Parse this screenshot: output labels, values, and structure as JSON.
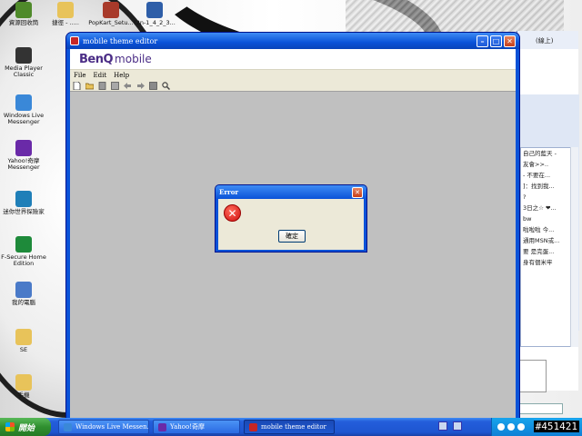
{
  "desktop": {
    "icons": [
      {
        "label": "資源回收筒",
        "color": "#4f8a2a"
      },
      {
        "label": "捷徑 - .....",
        "color": "#e8c35a"
      },
      {
        "label": "PopKart_Setu...",
        "color": "#a83a2a"
      },
      {
        "label": "(2n-1_4_2_3...",
        "color": "#2e5ea8"
      },
      {
        "label": "Media Player Classic",
        "color": "#333333"
      },
      {
        "label": "Windows Live Messenger",
        "color": "#3a88d8"
      },
      {
        "label": "Yahoo!奇摩 Messenger",
        "color": "#6a2aa8"
      },
      {
        "label": "迷你世界探險家",
        "color": "#1f7fb8"
      },
      {
        "label": "F-Secure Home Edition",
        "color": "#1e8a3a"
      },
      {
        "label": "我的電腦",
        "color": "#4a7ac8"
      },
      {
        "label": "SE",
        "color": "#e8c35a"
      },
      {
        "label": "手機",
        "color": "#e8c35a"
      }
    ]
  },
  "messenger": {
    "status": "(線上)",
    "lines": [
      "自己的藍天 -",
      "友會>>..",
      "- 不要在...",
      "]：找到我...",
      "?",
      "3日之☆ ❤...",
      "bw",
      "啦啦啦 今...",
      "通用MSN或...",
      "要 是完蛋...",
      "身有個米牢"
    ]
  },
  "window": {
    "title": "mobile theme editor",
    "brand_benq": "BenQ",
    "brand_mobile": "mobile",
    "menu": [
      "File",
      "Edit",
      "Help"
    ],
    "toolbar_icons": [
      "new-file-icon",
      "open-folder-icon",
      "save-icon",
      "properties-icon",
      "back-arrow-icon",
      "forward-arrow-icon",
      "grid-icon",
      "search-icon"
    ]
  },
  "dialog": {
    "title": "Error",
    "ok_label": "確定"
  },
  "taskbar": {
    "start_label": "開始",
    "tasks": [
      {
        "label": "Windows Live Messen...",
        "color": "#3a88d8"
      },
      {
        "label": "Yahoo!奇摩",
        "color": "#6a2aa8"
      },
      {
        "label": "mobile theme editor",
        "color": "#c62626"
      }
    ],
    "watermark": "#451421"
  }
}
